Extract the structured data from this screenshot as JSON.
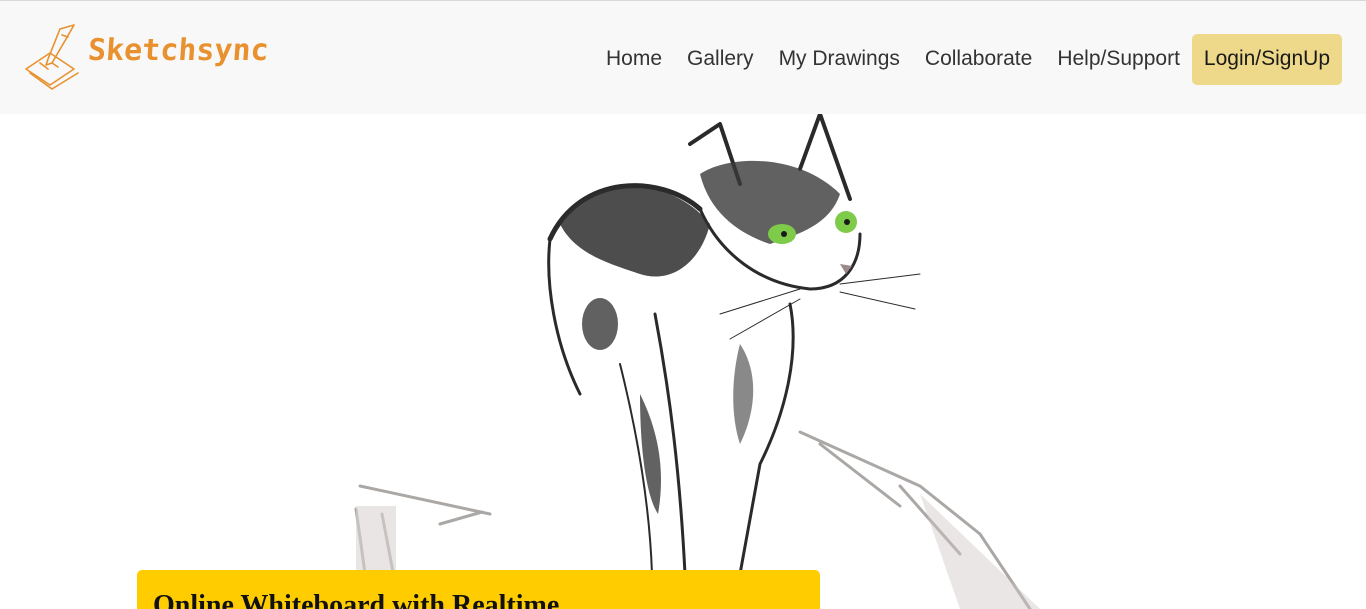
{
  "brand": {
    "name": "Sketchsync",
    "icon": "pencil-paper-icon",
    "color": "#e8912e"
  },
  "nav": {
    "links": [
      {
        "label": "Home"
      },
      {
        "label": "Gallery"
      },
      {
        "label": "My Drawings"
      },
      {
        "label": "Collaborate"
      },
      {
        "label": "Help/Support"
      }
    ],
    "login_label": "Login/SignUp",
    "login_color": "#eed88a"
  },
  "hero": {
    "image": "cat-sketch-illustration",
    "title": "Online Whiteboard with Realtime",
    "card_color": "#ffcc00"
  }
}
